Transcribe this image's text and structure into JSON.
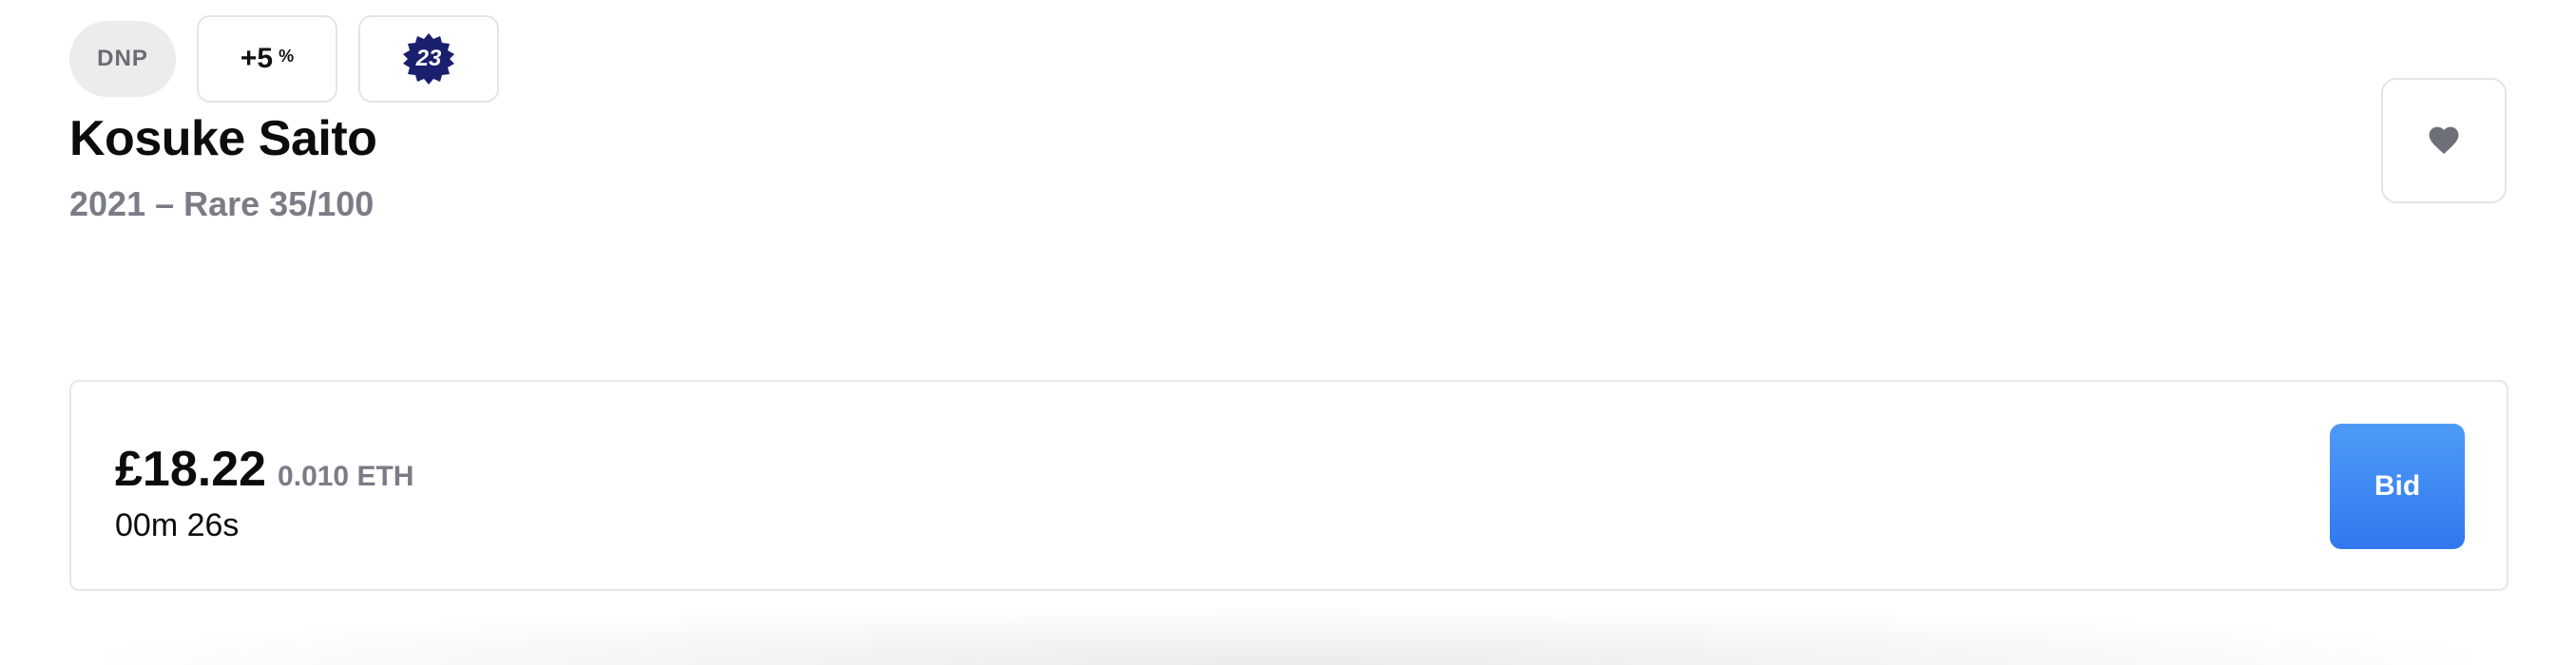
{
  "badges": {
    "status": "DNP",
    "bonus_value": "+5",
    "bonus_unit": "%",
    "jersey_number": "23"
  },
  "player": {
    "name": "Kosuke Saito",
    "edition": "2021 – Rare 35/100"
  },
  "icons": {
    "favorite": "heart-icon",
    "seal": "jersey-seal-icon"
  },
  "auction": {
    "price": "£18.22",
    "eth": "0.010 ETH",
    "time_left": "00m 26s",
    "bid_label": "Bid"
  },
  "colors": {
    "seal": "#1a1f6e",
    "bid_button": "#3b86f3",
    "muted_text": "#7a7c86"
  }
}
